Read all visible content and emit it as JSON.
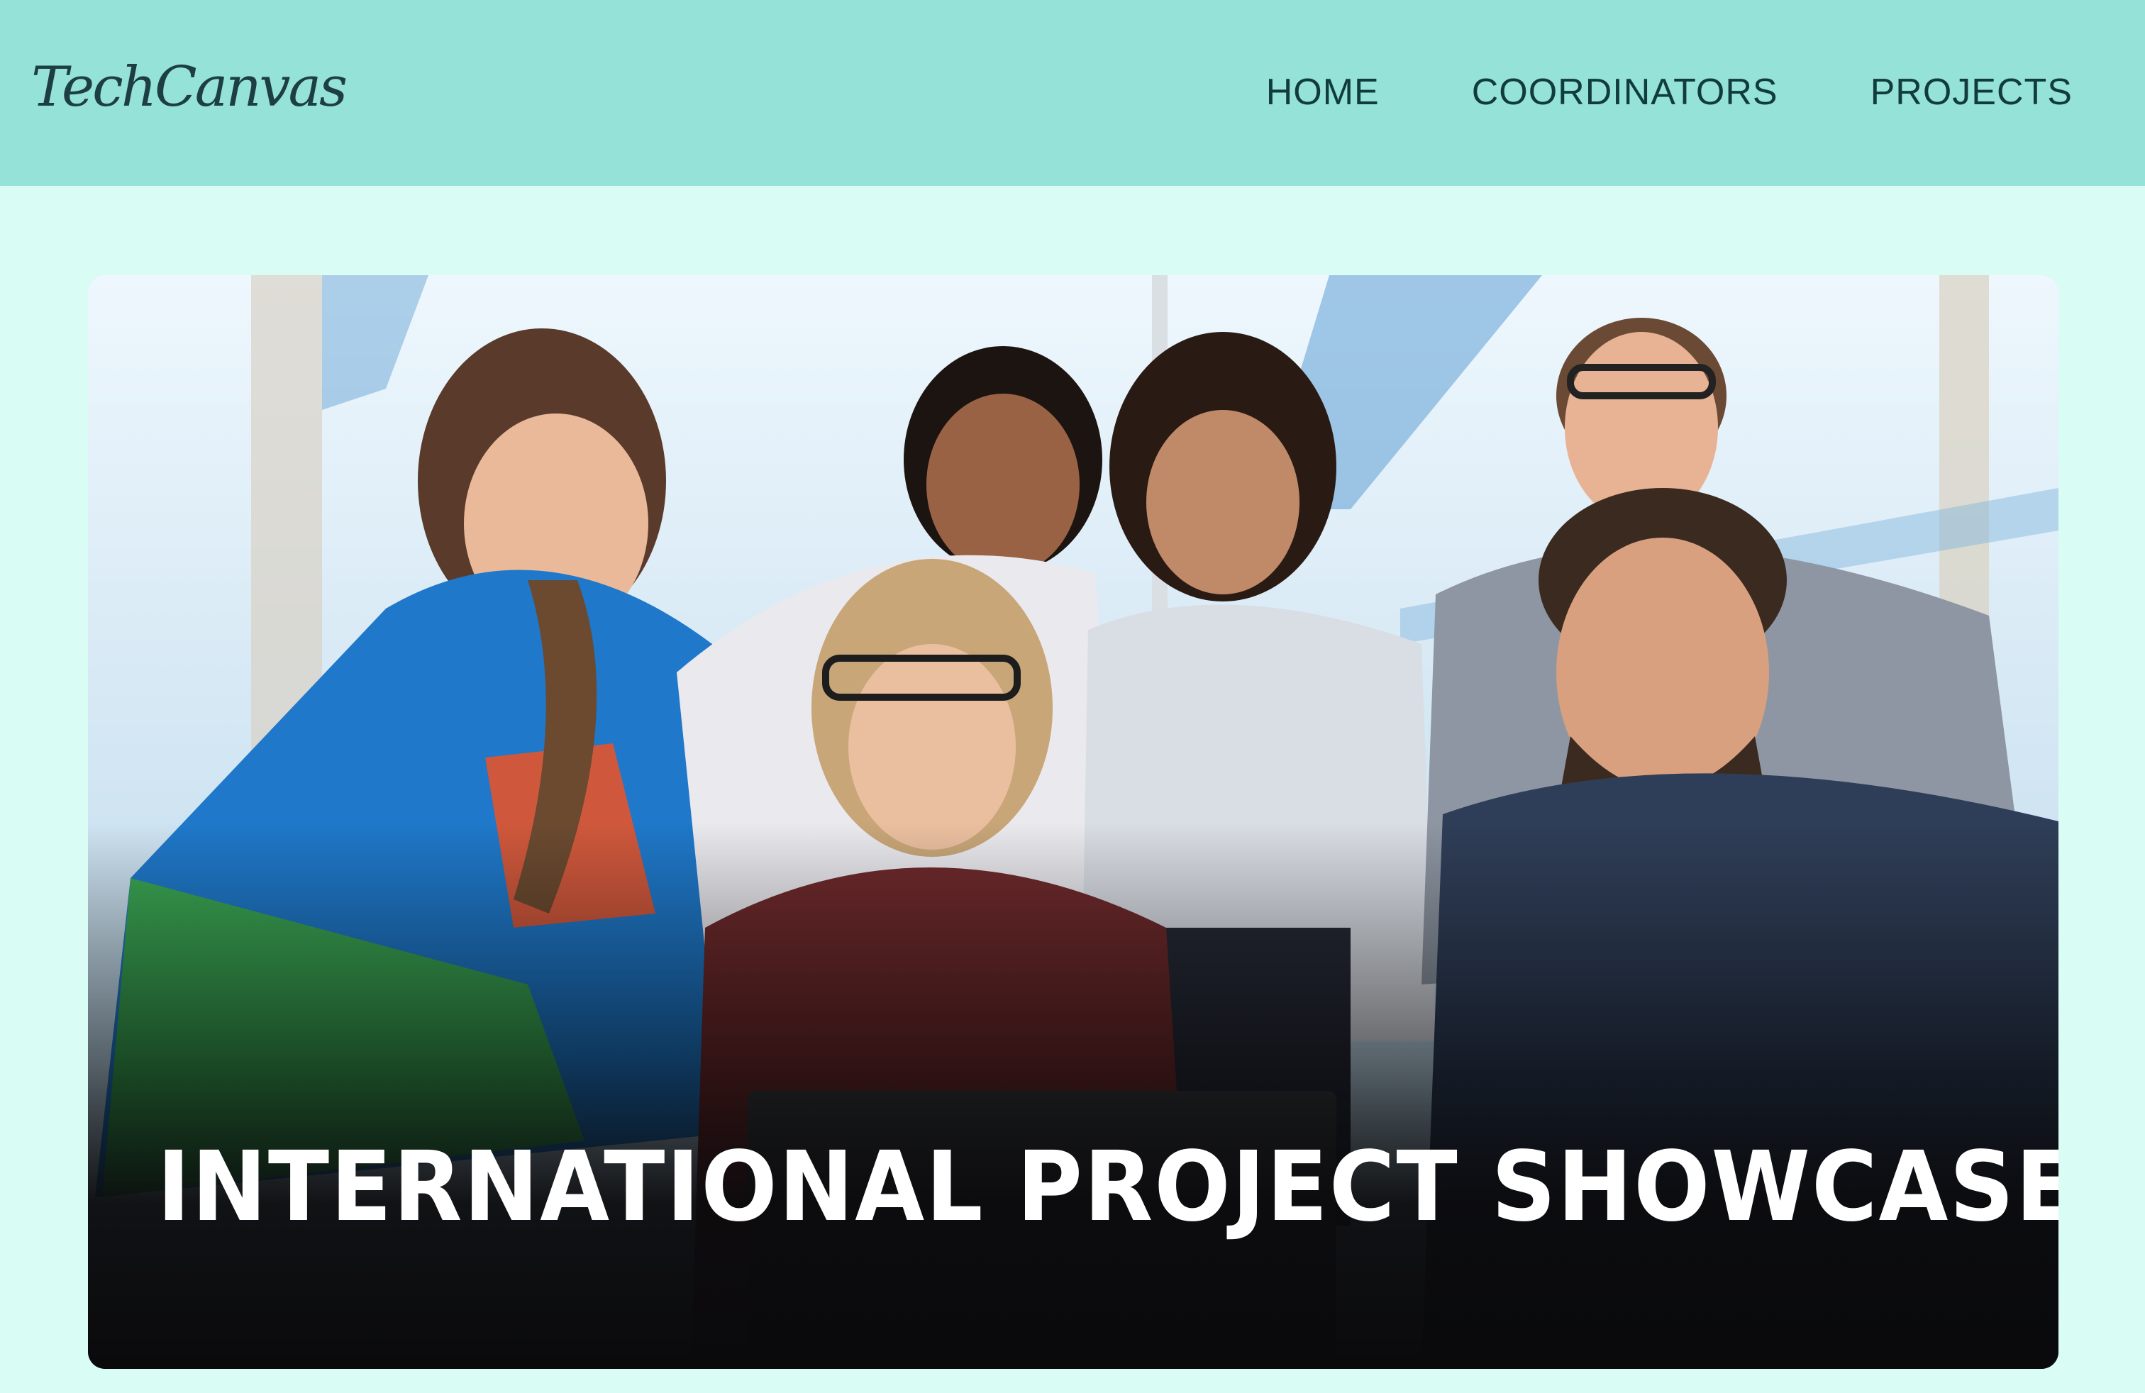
{
  "brand": {
    "logo_text": "TechCanvas",
    "colors": {
      "header_bg": "#94e2d8",
      "page_bg": "#d9fcf4",
      "nav_text": "#123b40"
    }
  },
  "nav": {
    "items": [
      {
        "label": "HOME"
      },
      {
        "label": "COORDINATORS"
      },
      {
        "label": "PROJECTS"
      }
    ]
  },
  "hero": {
    "title": "INTERNATIONAL PROJECT SHOWCASE",
    "image_icon": "group-photo"
  }
}
